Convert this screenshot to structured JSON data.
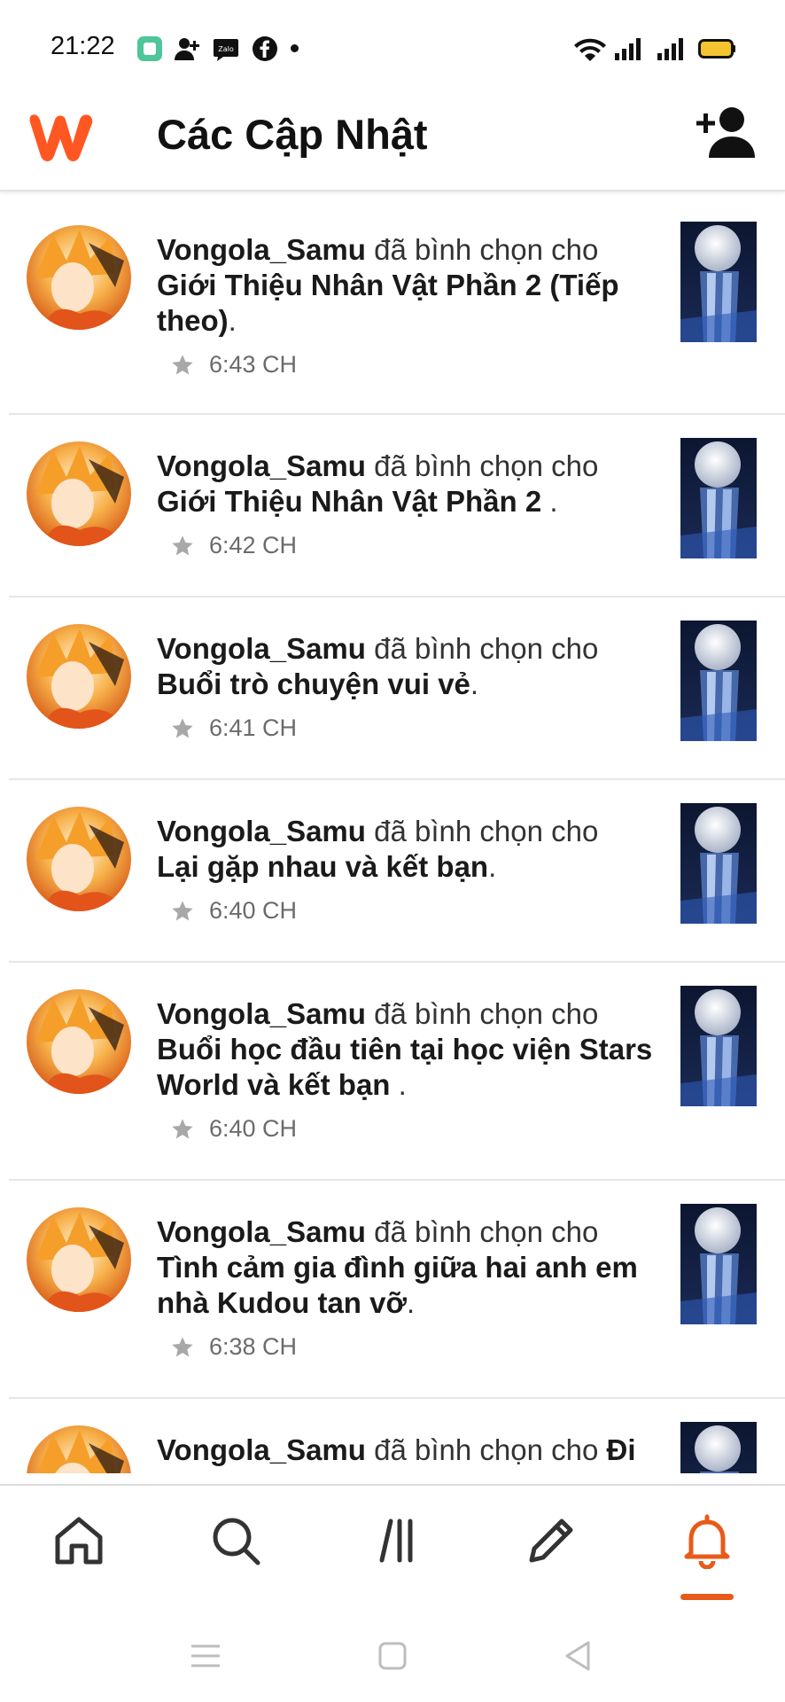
{
  "status": {
    "time": "21:22",
    "icons": [
      "app-icon",
      "add-contact-icon",
      "zalo-icon",
      "facebook-icon",
      "notification-dot",
      "wifi-icon",
      "signal-icon",
      "signal-icon",
      "battery-icon"
    ]
  },
  "header": {
    "title": "Các Cập Nhật",
    "logo_icon": "wattpad-logo",
    "action_icon": "add-user-icon"
  },
  "colors": {
    "accent": "#e85a1a",
    "text": "#111111",
    "meta": "#6b6b6b",
    "divider": "#e6e6e6"
  },
  "feed": {
    "items": [
      {
        "user": "Vongola_Samu",
        "action": "đã bình chọn cho",
        "story": "Giới Thiệu Nhân Vật Phần 2 (Tiếp theo)",
        "end": ".",
        "time": "6:43 CH"
      },
      {
        "user": "Vongola_Samu",
        "action": "đã bình chọn cho",
        "story": "Giới Thiệu Nhân Vật Phần 2 ",
        "end": ".",
        "time": "6:42 CH"
      },
      {
        "user": "Vongola_Samu",
        "action": "đã bình chọn cho",
        "story": "Buổi trò chuyện vui vẻ",
        "end": ".",
        "time": "6:41 CH"
      },
      {
        "user": "Vongola_Samu",
        "action": "đã bình chọn cho",
        "story": "Lại gặp nhau và kết bạn",
        "end": ".",
        "time": "6:40 CH"
      },
      {
        "user": "Vongola_Samu",
        "action": "đã bình chọn cho",
        "story": "Buổi học đầu tiên tại học viện Stars World và kết bạn ",
        "end": ".",
        "time": "6:40 CH"
      },
      {
        "user": "Vongola_Samu",
        "action": "đã bình chọn cho",
        "story": "Tình cảm gia đình giữa hai anh em nhà Kudou tan vỡ",
        "end": ".",
        "time": "6:38 CH"
      },
      {
        "user": "Vongola_Samu",
        "action": "đã bình chọn cho",
        "story": "Đi",
        "end": "",
        "time": ""
      }
    ]
  },
  "bottom_nav": {
    "items": [
      "home-icon",
      "search-icon",
      "library-icon",
      "write-icon",
      "notifications-icon"
    ],
    "active": "notifications-icon"
  },
  "system_nav": {
    "items": [
      "menu-icon",
      "home-square-icon",
      "back-icon"
    ]
  }
}
